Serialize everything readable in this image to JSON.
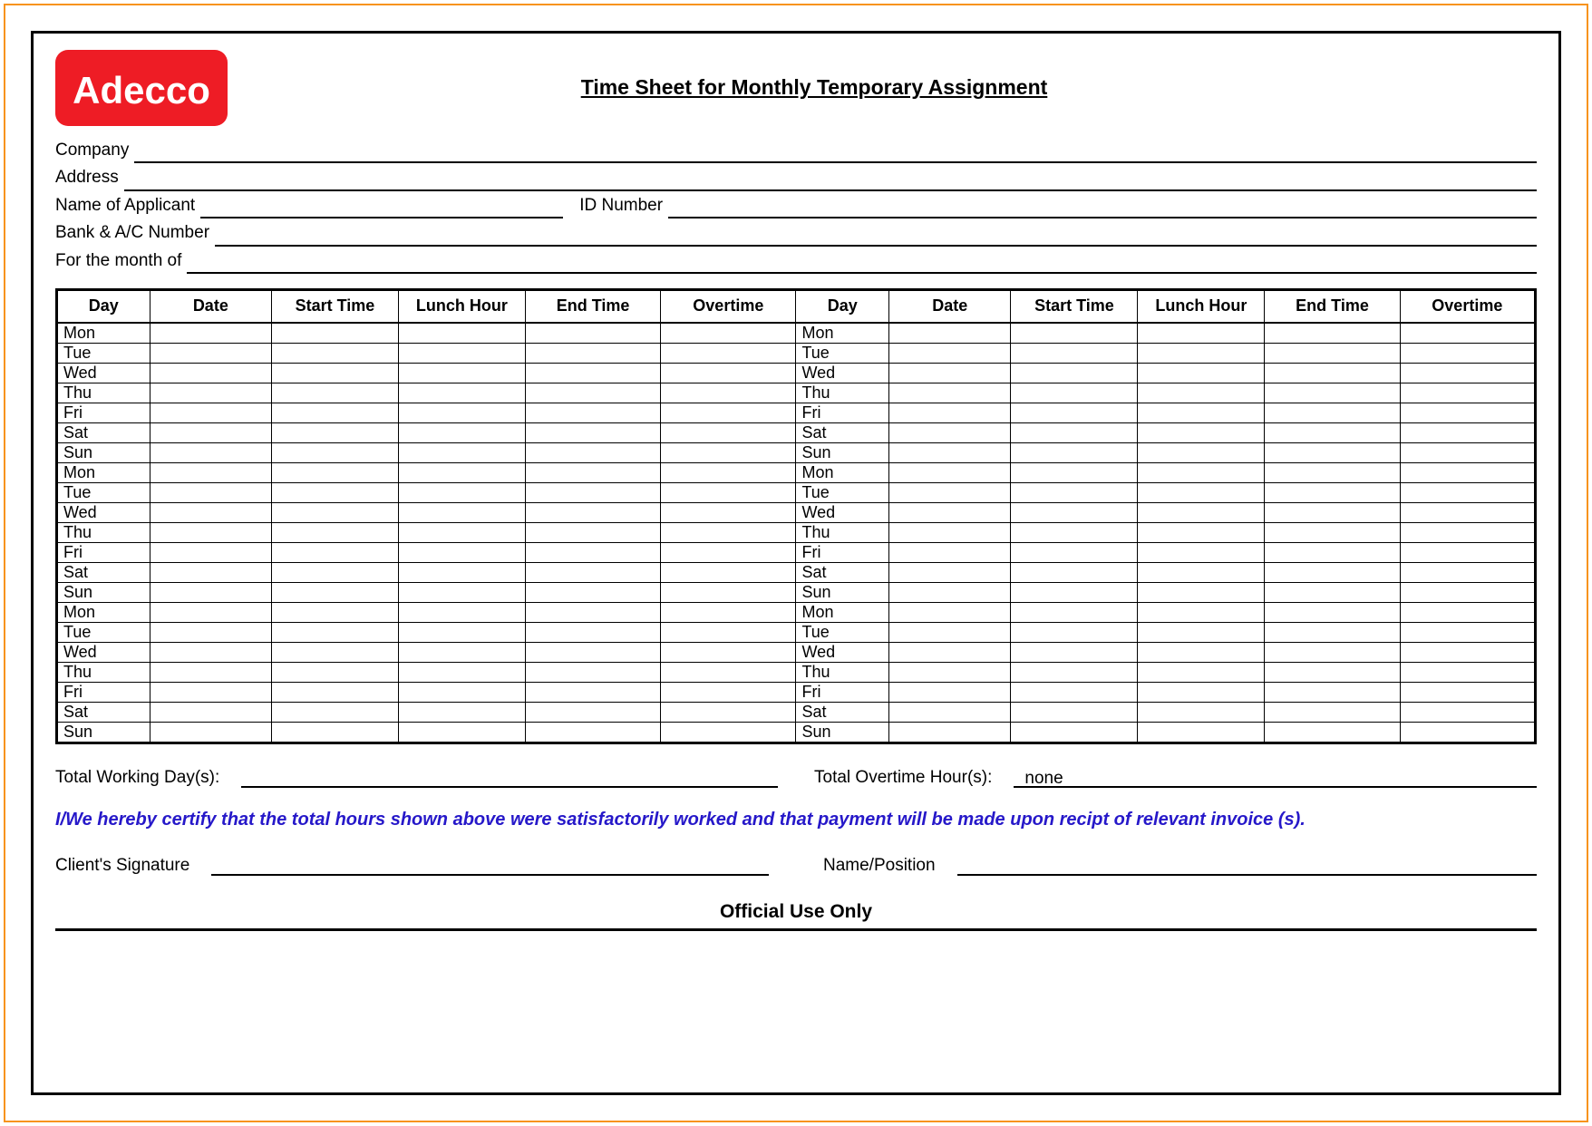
{
  "logo_text": "Adecco",
  "title": "Time Sheet for Monthly Temporary Assignment",
  "fields": {
    "company": "Company",
    "address": "Address",
    "applicant": "Name of Applicant",
    "id_number": "ID Number",
    "bank": "Bank & A/C Number",
    "month": "For the month of"
  },
  "table_headers": {
    "day": "Day",
    "date": "Date",
    "start": "Start Time",
    "lunch": "Lunch Hour",
    "end": "End Time",
    "overtime": "Overtime"
  },
  "days_left": [
    "Mon",
    "Tue",
    "Wed",
    "Thu",
    "Fri",
    "Sat",
    "Sun",
    "Mon",
    "Tue",
    "Wed",
    "Thu",
    "Fri",
    "Sat",
    "Sun",
    "Mon",
    "Tue",
    "Wed",
    "Thu",
    "Fri",
    "Sat",
    "Sun"
  ],
  "days_right": [
    "Mon",
    "Tue",
    "Wed",
    "Thu",
    "Fri",
    "Sat",
    "Sun",
    "Mon",
    "Tue",
    "Wed",
    "Thu",
    "Fri",
    "Sat",
    "Sun",
    "Mon",
    "Tue",
    "Wed",
    "Thu",
    "Fri",
    "Sat",
    "Sun"
  ],
  "totals": {
    "working_days_label": "Total Working Day(s):",
    "working_days_value": "",
    "overtime_label": "Total Overtime Hour(s):",
    "overtime_value": "none"
  },
  "certification": "I/We hereby certify that the total hours shown above were satisfactorily worked and that payment will be made upon recipt of relevant invoice (s).",
  "signature": {
    "client_label": "Client's Signature",
    "position_label": "Name/Position"
  },
  "official_use": "Official Use Only"
}
